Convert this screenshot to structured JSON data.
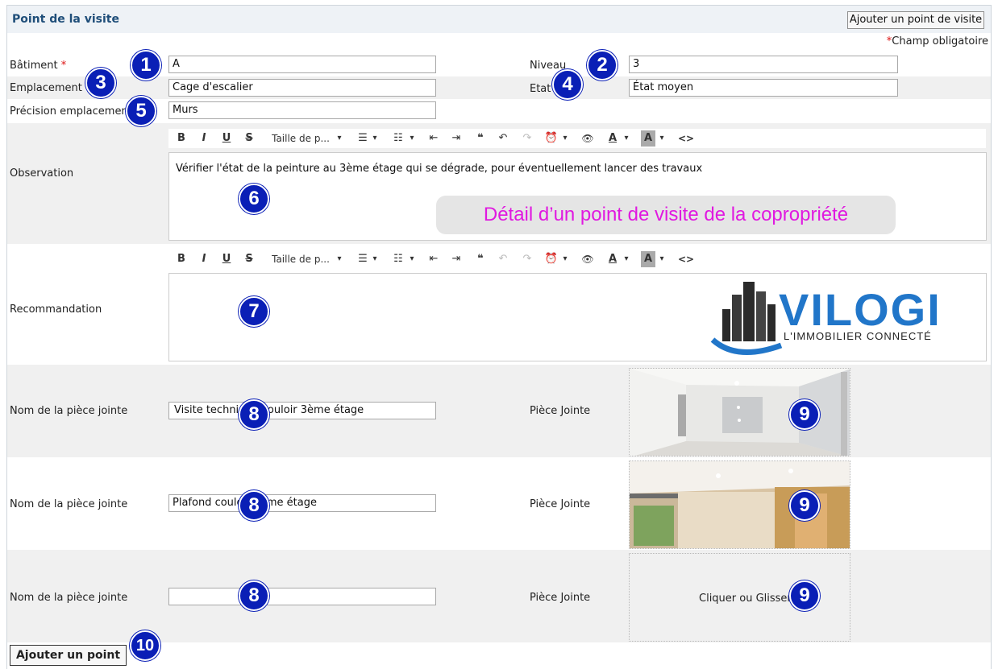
{
  "header": {
    "title": "Point de la visite",
    "add_visit_point_button": "Ajouter un point de visite"
  },
  "required_note": {
    "star": "*",
    "text": "Champ obligatoire"
  },
  "fields": {
    "batiment": {
      "label": "Bâtiment",
      "required": "*",
      "value": "A"
    },
    "niveau": {
      "label": "Niveau",
      "value": "3"
    },
    "emplacement": {
      "label": "Emplacement",
      "required": "*",
      "value": "Cage d'escalier"
    },
    "etat": {
      "label": "Etat",
      "value": "État moyen"
    },
    "precision": {
      "label": "Précision emplacement",
      "value": "Murs"
    }
  },
  "toolbar": {
    "bold": "B",
    "italic": "I",
    "underline": "U",
    "strike": "S",
    "font_size": "Taille de p...",
    "caret": "▾",
    "bullets": "☰",
    "numbered": "☷",
    "outdent": "⇤",
    "indent": "⇥",
    "quote": "❝",
    "undo": "↶",
    "redo": "↷",
    "clock": "⏰",
    "eye": "👁",
    "font_color": "A",
    "bg_color": "A",
    "code": "<>"
  },
  "observation": {
    "label": "Observation",
    "text": "Vérifier l'état de la peinture au 3ème étage qui se dégrade, pour éventuellement lancer des travaux"
  },
  "callout": {
    "text": "Détail d’un point de visite de la copropriété"
  },
  "recommandation": {
    "label": "Recommandation",
    "text": ""
  },
  "logo": {
    "name": "VILOGI",
    "tagline": "L'IMMOBILIER CONNECTÉ"
  },
  "attachments": [
    {
      "name_label": "Nom de la pièce jointe",
      "name_value": "Visite technique couloir 3ème étage",
      "file_label": "Pièce Jointe"
    },
    {
      "name_label": "Nom de la pièce jointe",
      "name_value": "Plafond couloir 3ème étage",
      "file_label": "Pièce Jointe"
    },
    {
      "name_label": "Nom de la pièce jointe",
      "name_value": "",
      "file_label": "Pièce Jointe",
      "drop_text": "Cliquer ou Glisser"
    }
  ],
  "add_point_button": "Ajouter un point",
  "badges": [
    "1",
    "2",
    "3",
    "4",
    "5",
    "6",
    "7",
    "8",
    "8",
    "8",
    "9",
    "9",
    "9",
    "10"
  ],
  "colors": {
    "header_text": "#1f4e79",
    "badge": "#0a1fb6",
    "callout_text": "#e019e0",
    "required": "#d11111"
  }
}
